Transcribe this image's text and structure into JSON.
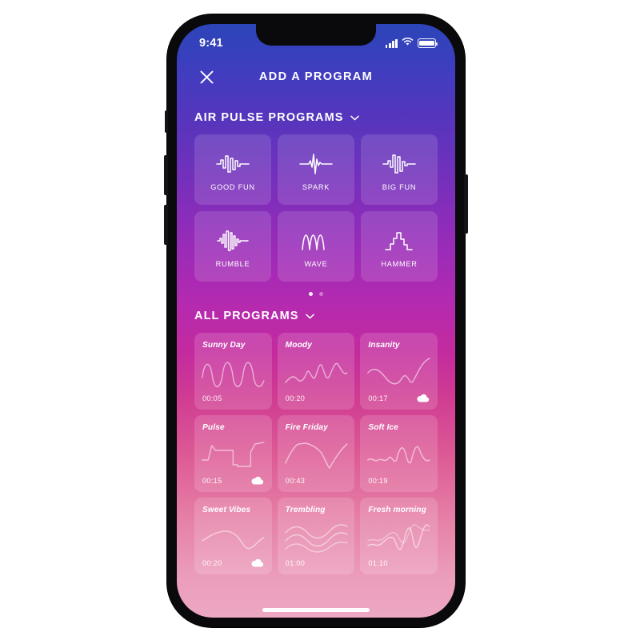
{
  "device": {
    "status_bar": {
      "time": "9:41",
      "signal_icon": "cellular-bars-icon",
      "wifi_icon": "wifi-icon",
      "battery_icon": "battery-full-icon"
    },
    "home_indicator": "home-indicator"
  },
  "header": {
    "close_icon": "close-x-icon",
    "title": "ADD A PROGRAM"
  },
  "air_pulse": {
    "section_label": "AIR PULSE PROGRAMS",
    "chevron_icon": "chevron-down-icon",
    "cards": [
      {
        "label": "GOOD FUN",
        "icon": "waveform-square-burst-icon"
      },
      {
        "label": "SPARK",
        "icon": "waveform-ecg-spike-icon"
      },
      {
        "label": "BIG FUN",
        "icon": "waveform-square-cluster-icon"
      },
      {
        "label": "RUMBLE",
        "icon": "waveform-dense-bars-icon"
      },
      {
        "label": "WAVE",
        "icon": "waveform-sine-icon"
      },
      {
        "label": "HAMMER",
        "icon": "waveform-staircase-icon"
      }
    ],
    "pager": {
      "total": 2,
      "active": 1
    }
  },
  "all_programs": {
    "section_label": "ALL PROGRAMS",
    "chevron_icon": "chevron-down-icon",
    "cloud_icon": "cloud-upload-icon",
    "cards": [
      {
        "name": "Sunny Day",
        "duration": "00:05",
        "cloud": false,
        "wave": "sine-smooth"
      },
      {
        "name": "Moody",
        "duration": "00:20",
        "cloud": false,
        "wave": "irregular-rising"
      },
      {
        "name": "Insanity",
        "duration": "00:17",
        "cloud": true,
        "wave": "dip-then-climb"
      },
      {
        "name": "Pulse",
        "duration": "00:15",
        "cloud": true,
        "wave": "square-step"
      },
      {
        "name": "Fire Friday",
        "duration": "00:43",
        "cloud": false,
        "wave": "plateau-valley"
      },
      {
        "name": "Soft Ice",
        "duration": "00:19",
        "cloud": false,
        "wave": "ripple-peaks"
      },
      {
        "name": "Sweet Vibes",
        "duration": "00:20",
        "cloud": true,
        "wave": "gentle-dip"
      },
      {
        "name": "Trembling",
        "duration": "01:00",
        "cloud": false,
        "wave": "multi-strand"
      },
      {
        "name": "Fresh  morning",
        "duration": "01:10",
        "cloud": false,
        "wave": "layered-spikes"
      }
    ]
  },
  "colors": {
    "gradient_top": "#2c45b8",
    "gradient_mid": "#b42ab0",
    "gradient_bottom": "#eda8c3",
    "card_overlay": "rgba(255,255,255,0.14)",
    "text": "#ffffff",
    "frame": "#0a0a0c"
  }
}
